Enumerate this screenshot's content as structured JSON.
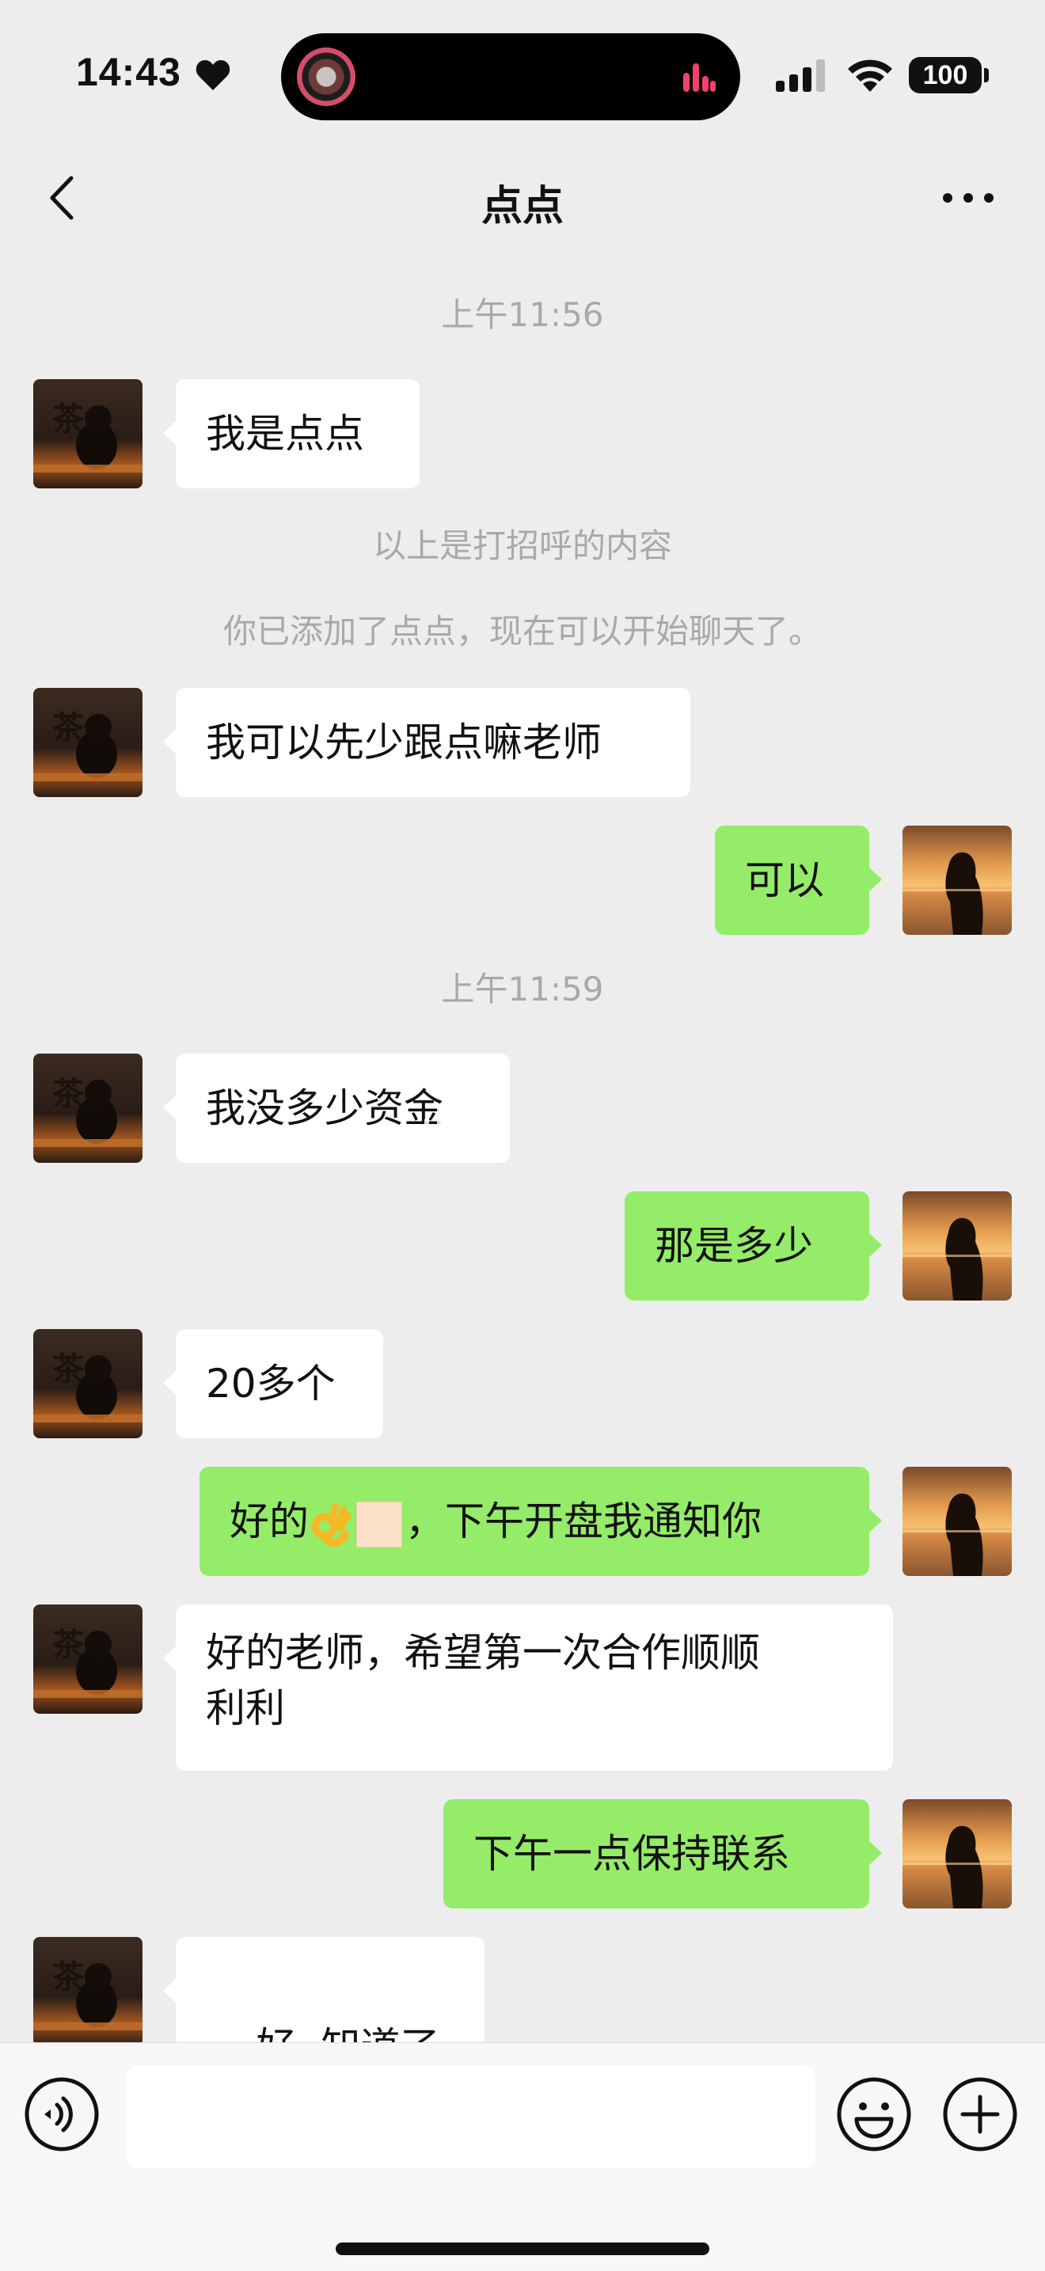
{
  "status_bar": {
    "time": "14:43",
    "battery": "100",
    "icons": [
      "heart-icon",
      "music-equalizer-icon",
      "cellular-signal-icon",
      "wifi-icon",
      "battery-icon"
    ]
  },
  "nav": {
    "title": "点点",
    "back_icon": "chevron-left-icon",
    "more_icon": "more-dots-icon"
  },
  "messages": [
    {
      "type": "time",
      "text": "上午11:56"
    },
    {
      "type": "msg",
      "side": "left",
      "text": "我是点点"
    },
    {
      "type": "system",
      "text": "以上是打招呼的内容"
    },
    {
      "type": "system",
      "text": "你已添加了点点，现在可以开始聊天了。"
    },
    {
      "type": "msg",
      "side": "left",
      "text": "我可以先少跟点嘛老师"
    },
    {
      "type": "msg",
      "side": "right",
      "text": "可以"
    },
    {
      "type": "time",
      "text": "上午11:59"
    },
    {
      "type": "msg",
      "side": "left",
      "text": "我没多少资金"
    },
    {
      "type": "msg",
      "side": "right",
      "text": "那是多少"
    },
    {
      "type": "msg",
      "side": "left",
      "text": "20多个"
    },
    {
      "type": "msg",
      "side": "right",
      "text_before": "好的",
      "text_after": "，下午开盘我通知你",
      "emoji": "ok-hand-emoji"
    },
    {
      "type": "msg",
      "side": "left",
      "text_line1": "好的老师，希望第一次合作顺顺",
      "text_line2": "利利"
    },
    {
      "type": "msg",
      "side": "right",
      "text": "下午一点保持联系"
    },
    {
      "type": "msg",
      "side": "left",
      "text": "好  知道了，"
    }
  ],
  "input_bar": {
    "voice_icon": "voice-input-icon",
    "emoji_icon": "emoji-face-icon",
    "plus_icon": "plus-circle-icon",
    "value": ""
  },
  "colors": {
    "background": "#ededed",
    "bubble_self": "#95ec69",
    "bubble_other": "#ffffff",
    "system_text": "#a9a9a9"
  }
}
